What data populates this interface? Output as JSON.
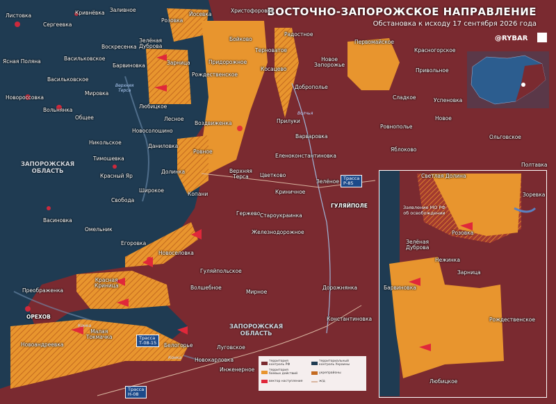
{
  "header": {
    "title": "ВОСТОЧНО-ЗАПОРОЖСКОЕ НАПРАВЛЕНИЕ",
    "subtitle": "Обстановка к исходу 17 сентября 2026 года",
    "logo": "@RYBAR"
  },
  "colors": {
    "russian_control": "#7a2a30",
    "ukrainian_control": "#1f3b52",
    "combat_zone": "#e8952e",
    "accent_red": "#e0283a",
    "road_blue": "#1d4a8a"
  },
  "icons": [
    "attack-arrow-icon",
    "strike-marker-icon",
    "qr-code-icon",
    "ukraine-overview-map"
  ],
  "regions": {
    "zaporizhzhia_west": "ЗАПОРОЖСКАЯ\nОБЛАСТЬ",
    "zaporizhzhia_south": "ЗАПОРОЖСКАЯ\nОБЛАСТЬ"
  },
  "roads": {
    "r85": "Трасса\nР-85",
    "t0815": "Трасса\nТ-08-15",
    "h08": "Трасса\nН-08"
  },
  "rivers": {
    "gaychur": "Верхняя\nТерса",
    "kon": "Конка",
    "volchya": "Волчья"
  },
  "towns": {
    "listvyanka": "Листовка",
    "kryvnovka": "Кривнёвка",
    "zalivnoe": "Заливное",
    "serguievka": "Сергеевка",
    "yasnaya_polyana": "Ясная Поляна",
    "voskresenka": "Воскресенка",
    "vasylkovskoe": "Васильковское",
    "vasylkovskoe2": "Васильковское",
    "barvinovka": "Барвиновка",
    "zelenaya_dubrova": "Зелёная\nДуброва",
    "rozovka": "Розовка",
    "yosevka": "Йосевка",
    "khristoforovka": "Христофоровка",
    "boykovo": "Бойково",
    "ternovatoe": "Терноватое",
    "radostnoe": "Радостное",
    "pervomaiskoe": "Первомайское",
    "krasnogorskoe": "Красногорское",
    "prydorozhnoe": "Придорожное",
    "kosatsevo": "Косацево",
    "novoe_zaporozhye": "Новое\nЗапорожье",
    "privolnoe": "Привольное",
    "zarnitsa": "Зарница",
    "rozhdestvenskoe": "Рождественское",
    "novorossovka": "Новороссовка",
    "volnyanka": "Вольнянка",
    "mirovka": "Мировка",
    "obschee": "Общее",
    "lyubitskoe": "Любицкое",
    "lesnoe": "Лесное",
    "novosolichino": "Новосолошино",
    "vozdvizhenka": "Воздвиженка",
    "dobropolye": "Доброполье",
    "sladkoe": "Сладкое",
    "uspenovka": "Успеновка",
    "prilukki": "Прилуки",
    "novoe": "Новое",
    "rovnopolye": "Ровнополье",
    "nikolskoe": "Никольское",
    "danilovka": "Даниловка",
    "varvarovka": "Варваровка",
    "olgovskoe": "Ольговское",
    "yablokovo": "Яблоково",
    "timoshevka": "Тимошевка",
    "rovnoe": "Ровное",
    "dolinka": "Долинка",
    "eleno": "Еленоконстантиновка",
    "poltavka": "Полтавка",
    "krasny_yar": "Красный Яр",
    "shirokoe": "Широкое",
    "verkhnyaya_tersa": "Верхняя\nТерса",
    "tsvetkovo": "Цветково",
    "zelenoe": "Зелёное",
    "svoboda": "Свобода",
    "kopani": "Копани",
    "krinichnoe": "Криничное",
    "gulyaipole": "ГУЛЯЙПОЛЕ",
    "vasinovka": "Васиновка",
    "gerzhevo": "Гержево",
    "staroukrainka": "Староукраинка",
    "omelnik": "Омельник",
    "zheleznodorozhnoe": "Железнодорожное",
    "egorovka": "Егоровка",
    "novoselovka": "Новоселовка",
    "preobrazhenka": "Преображенка",
    "gulyaipolskoe": "Гуляйпольское",
    "krasnaya_krinitsa": "Красная\nКриница",
    "volshebnoe": "Волшебное",
    "mirnoe": "Мирное",
    "dorozhnyanka": "Дорожнянка",
    "orekhov": "ОРЕХОВ",
    "malaya_tokmachka": "Малая\nТокмачка",
    "konstantinovka": "Константиновка",
    "novoandreevka": "Новоандреевка",
    "belogorye": "Белогорье",
    "lugovskoe": "Луговское",
    "novokarlovka": "Новокарловка",
    "inzhenernoe": "Инженерное"
  },
  "inset": {
    "svetlaya_dolina": "Светлая Долина",
    "zorevka": "Зоревка",
    "callout": "Заявление МО РФ\nоб освобождении",
    "rozovka": "Розовка",
    "zelenaya_dubrova": "Зелёная\nДуброва",
    "nezhenka": "Нежинка",
    "zarnitsa": "Зарница",
    "barvinovka": "Барвиновка",
    "rozhdestvenskoe": "Рождественское",
    "lyubitskoe": "Любицкое"
  },
  "legend": {
    "item1": "территория\nконтроль РФ",
    "item2": "территория\nбоевых действий",
    "item3": "территориальный\nконтроль Украины",
    "item4": "укрепрайоны",
    "item5": "вектор наступления",
    "item6": "ж/д"
  }
}
